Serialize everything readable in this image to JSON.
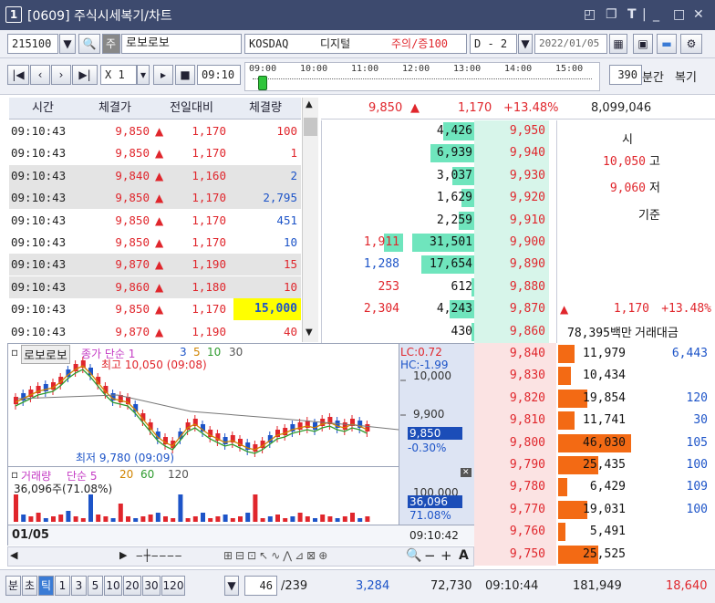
{
  "title": {
    "num": "1",
    "text": "[0609] 주식시세복기/차트"
  },
  "top": {
    "code": "215100",
    "stock_type": "주",
    "name": "로보로보",
    "market": "KOSDAQ",
    "sector": "디지털",
    "warn": "주의/증100",
    "mode": "D - 2",
    "date": "2022/01/05"
  },
  "play": {
    "speed": "X 1",
    "time": "09:10",
    "ticks": [
      "09:00",
      "10:00",
      "11:00",
      "12:00",
      "13:00",
      "14:00",
      "15:00"
    ],
    "interval": "390",
    "unit": "분간",
    "restore": "복기"
  },
  "table": {
    "headers": [
      "시간",
      "체결가",
      "전일대비",
      "체결량"
    ],
    "rows": [
      {
        "t": "09:10:43",
        "p": "9,850",
        "d": "1,170",
        "v": "100",
        "g": false,
        "vc": "red"
      },
      {
        "t": "09:10:43",
        "p": "9,850",
        "d": "1,170",
        "v": "1",
        "g": false,
        "vc": "red"
      },
      {
        "t": "09:10:43",
        "p": "9,840",
        "d": "1,160",
        "v": "2",
        "g": true,
        "vc": "blue"
      },
      {
        "t": "09:10:43",
        "p": "9,850",
        "d": "1,170",
        "v": "2,795",
        "g": true,
        "vc": "blue"
      },
      {
        "t": "09:10:43",
        "p": "9,850",
        "d": "1,170",
        "v": "451",
        "g": false,
        "vc": "blue"
      },
      {
        "t": "09:10:43",
        "p": "9,850",
        "d": "1,170",
        "v": "10",
        "g": false,
        "vc": "blue"
      },
      {
        "t": "09:10:43",
        "p": "9,870",
        "d": "1,190",
        "v": "15",
        "g": true,
        "vc": "red"
      },
      {
        "t": "09:10:43",
        "p": "9,860",
        "d": "1,180",
        "v": "10",
        "g": true,
        "vc": "red"
      },
      {
        "t": "09:10:43",
        "p": "9,850",
        "d": "1,170",
        "v": "15,000",
        "g": false,
        "vc": "hl"
      },
      {
        "t": "09:10:43",
        "p": "9,870",
        "d": "1,190",
        "v": "40",
        "g": false,
        "vc": "red"
      }
    ]
  },
  "summary": {
    "price": "9,850",
    "change": "1,170",
    "rate": "+13.48%",
    "volume": "8,099,046"
  },
  "asks": [
    {
      "q": "4,426",
      "p": "9,950",
      "f": 0.5
    },
    {
      "q": "6,939",
      "p": "9,940",
      "f": 0.7
    },
    {
      "q": "3,037",
      "p": "9,930",
      "f": 0.35
    },
    {
      "q": "1,629",
      "p": "9,920",
      "f": 0.2
    },
    {
      "q": "2,259",
      "p": "9,910",
      "f": 0.25
    },
    {
      "q": "31,501",
      "p": "9,900",
      "f": 1.0
    },
    {
      "q": "17,654",
      "p": "9,890",
      "f": 0.85
    },
    {
      "q": "612",
      "p": "9,880",
      "f": 0.05
    },
    {
      "q": "4,243",
      "p": "9,870",
      "f": 0.4
    },
    {
      "q": "430",
      "p": "9,860",
      "f": 0.05
    }
  ],
  "ask_side": [
    {
      "n": "1,911",
      "c": "red",
      "f": 0.3
    },
    {
      "n": "1,288",
      "c": "blue",
      "f": 0
    },
    {
      "n": "253",
      "c": "red",
      "f": 0
    },
    {
      "n": "2,304",
      "c": "red",
      "f": 0
    }
  ],
  "info": {
    "open_label": "시",
    "high": "10,050",
    "high_label": "고",
    "low": "9,060",
    "low_label": "저",
    "base_label": "기준",
    "chg": "1,170",
    "rate": "+13.48%",
    "amount": "78,395백만",
    "amount_label": "거래대금"
  },
  "bids": [
    {
      "p": "9,840",
      "q": "11,979",
      "x": "6,443",
      "f": 0.22
    },
    {
      "p": "9,830",
      "q": "10,434",
      "x": "",
      "f": 0.18
    },
    {
      "p": "9,820",
      "q": "19,854",
      "x": "120",
      "f": 0.4
    },
    {
      "p": "9,810",
      "q": "11,741",
      "x": "30",
      "f": 0.22
    },
    {
      "p": "9,800",
      "q": "46,030",
      "x": "105",
      "f": 1.0
    },
    {
      "p": "9,790",
      "q": "25,435",
      "x": "100",
      "f": 0.55
    },
    {
      "p": "9,780",
      "q": "6,429",
      "x": "109",
      "f": 0.12
    },
    {
      "p": "9,770",
      "q": "19,031",
      "x": "100",
      "f": 0.4
    },
    {
      "p": "9,760",
      "q": "5,491",
      "x": "",
      "f": 0.1
    },
    {
      "p": "9,750",
      "q": "25,525",
      "x": "",
      "f": 0.55
    }
  ],
  "chart": {
    "name": "로보로보",
    "ma": "종가 단순 1",
    "ma_vals": [
      "3",
      "5",
      "10",
      "30"
    ],
    "high_note": "최고 10,050 (09:08)",
    "low_note": "최저 9,780 (09:09)",
    "lc": "LC:0.72",
    "hc": "HC:-1.99",
    "y1": "10,000",
    "y2": "9,900",
    "cur": "9,850",
    "cur_rate": "-0.30%",
    "vol_title": "거래량",
    "vol_ma": "단순 5",
    "vol_ma_vals": [
      "20",
      "60",
      "120"
    ],
    "vol_val": "36,096주(71.08%)",
    "vol_axis": "100,000",
    "vol_cur": "36,096",
    "vol_rate": "71.08%",
    "date": "01/05",
    "time": "09:10:42"
  },
  "bottom": {
    "tabs": [
      "분",
      "초",
      "틱",
      "1",
      "3",
      "5",
      "10",
      "20",
      "30",
      "120"
    ],
    "count": "46",
    "total": "/239",
    "sum1": "3,284",
    "sum2": "72,730",
    "time": "09:10:44",
    "sum3": "181,949",
    "sum4": "18,640"
  }
}
